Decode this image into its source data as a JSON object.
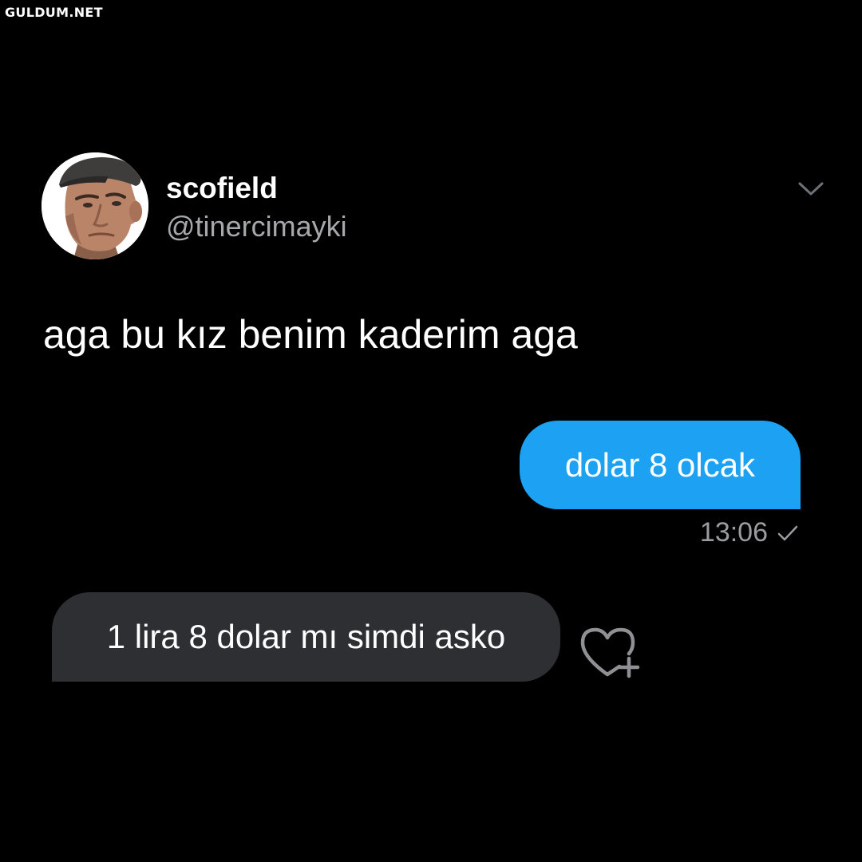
{
  "watermark": "GULDUM.NET",
  "tweet": {
    "display_name": "scofield",
    "handle": "@tinercimayki",
    "text": "aga bu kız benim kaderim aga",
    "avatar_icon": "profile-photo",
    "menu_icon": "chevron-down-icon"
  },
  "messages": {
    "sent": {
      "text": "dolar 8 olcak",
      "time": "13:06",
      "status_icon": "check-icon"
    },
    "received": {
      "text": "1 lira 8 dolar mı simdi asko",
      "reaction_icon": "heart-plus-icon"
    }
  },
  "colors": {
    "background": "#000000",
    "sent_bubble": "#1da1f2",
    "received_bubble": "#2d2f33",
    "secondary_text": "#9a9ca0"
  }
}
